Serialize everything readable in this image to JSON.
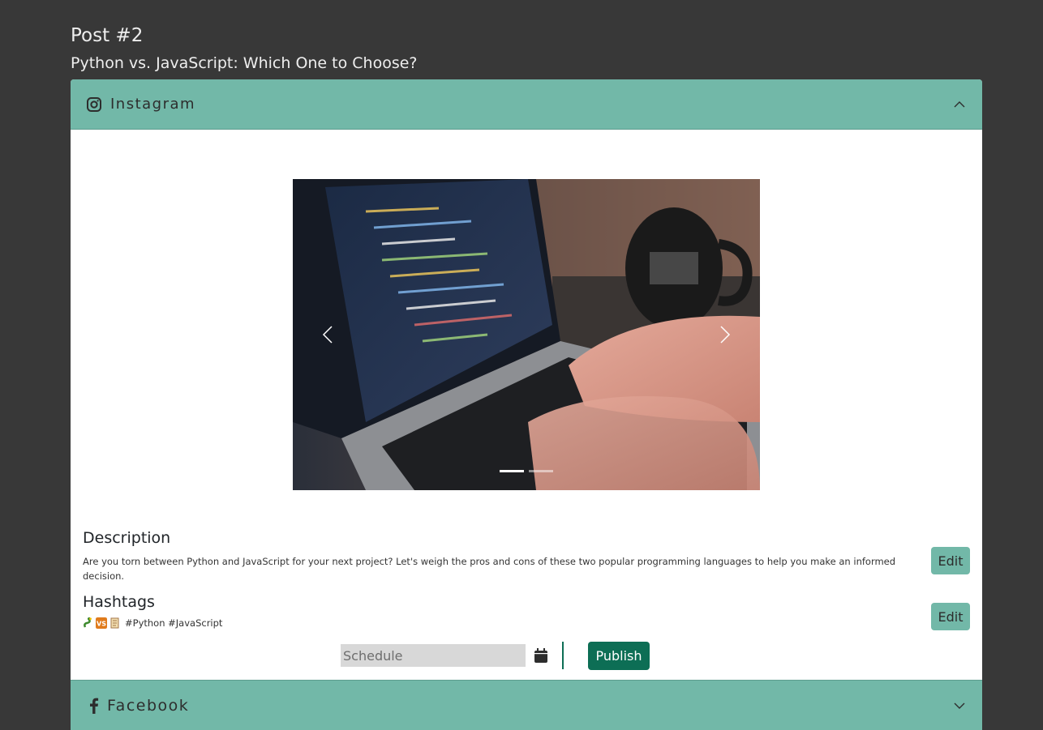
{
  "post": {
    "number": "Post #2",
    "title": "Python vs. JavaScript: Which One to Choose?"
  },
  "instagram": {
    "label": "Instagram",
    "icon": "instagram-icon",
    "expanded": true,
    "carousel": {
      "slide_count": 2,
      "active_index": 0,
      "image": "laptop-coding-photo"
    },
    "description": {
      "heading": "Description",
      "text": "Are you torn between Python and JavaScript for your next project? Let's weigh the pros and cons of these two popular programming languages to help you make an informed decision.",
      "edit_label": "Edit"
    },
    "hashtags": {
      "heading": "Hashtags",
      "emojis": [
        "snake",
        "vs",
        "scroll"
      ],
      "text": "#Python #JavaScript",
      "edit_label": "Edit"
    },
    "schedule_placeholder": "Schedule",
    "publish_label": "Publish"
  },
  "facebook": {
    "label": "Facebook",
    "icon": "facebook-icon",
    "expanded": false
  },
  "colors": {
    "background": "#383838",
    "header": "#72b8a8",
    "primary": "#0d6e55"
  }
}
